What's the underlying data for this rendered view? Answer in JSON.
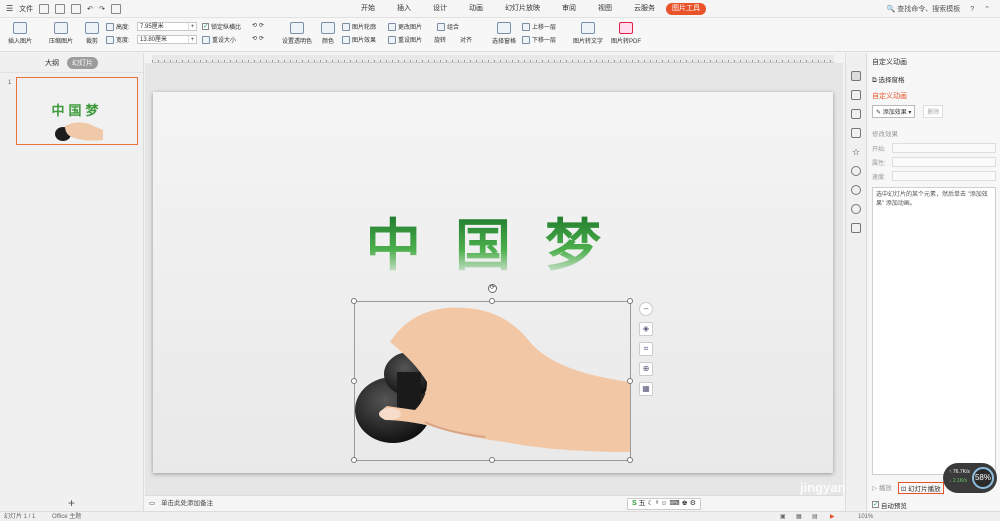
{
  "menubar": {
    "file_label": "文件",
    "tabs": [
      {
        "label": "开始",
        "active": false
      },
      {
        "label": "插入",
        "active": false
      },
      {
        "label": "设计",
        "active": false
      },
      {
        "label": "动画",
        "active": false
      },
      {
        "label": "幻灯片放映",
        "active": false
      },
      {
        "label": "审阅",
        "active": false
      },
      {
        "label": "视图",
        "active": false
      },
      {
        "label": "云服务",
        "active": false
      },
      {
        "label": "图片工具",
        "active": true
      }
    ],
    "search_label": "查找命令、搜索模板",
    "help_label": "?"
  },
  "ribbon": {
    "insert_picture": "插入图片",
    "compress_picture": "压缩图片",
    "crop": "裁剪",
    "height_label": "高度:",
    "height_value": "7.95厘米",
    "width_label": "宽度:",
    "width_value": "13.80厘米",
    "lock_ratio": "锁定纵横比",
    "reset_size": "重设大小",
    "set_transparent": "设置透明色",
    "color": "颜色",
    "picture_outline": "图片轮廓",
    "picture_effect": "图片效果",
    "change_picture": "更改图片",
    "reset_picture": "重设图片",
    "combine": "组合",
    "rotate": "旋转",
    "align": "对齐",
    "selection_pane": "选择窗格",
    "bring_forward": "上移一层",
    "send_backward": "下移一层",
    "picture_to_text": "图片转文字",
    "picture_to_pdf": "图片转PDF"
  },
  "leftpanel": {
    "tab_outline": "大纲",
    "tab_slides": "幻灯片",
    "slide_number": "1",
    "thumb_title": "中国梦"
  },
  "slide": {
    "title": "中国梦"
  },
  "notes": {
    "placeholder": "单击此处添加备注"
  },
  "status": {
    "slide_info": "幻灯片 1 / 1",
    "theme": "Office 主题",
    "zoom": "101%"
  },
  "rightpanel": {
    "title": "自定义动画",
    "selection_pane": "选择窗格",
    "section_title": "自定义动画",
    "add_effect": "添加效果",
    "delete": "删除",
    "modify_effect": "修改效果",
    "start_label": "开始:",
    "property_label": "属性:",
    "speed_label": "速度:",
    "hint": "选中幻灯片的某个元素，然后单击 \"添加效果\" 添加动画。",
    "play": "播放",
    "slideshow": "幻灯片播放",
    "autopreview": "自动预览"
  },
  "netspeed": {
    "up": "76.7K/s",
    "down": "2.1K/s",
    "percent": "58%"
  },
  "watermark": "jingyan.baidu.com",
  "colors": {
    "accent": "#e8532a",
    "title_green": "#3d9a3a"
  }
}
